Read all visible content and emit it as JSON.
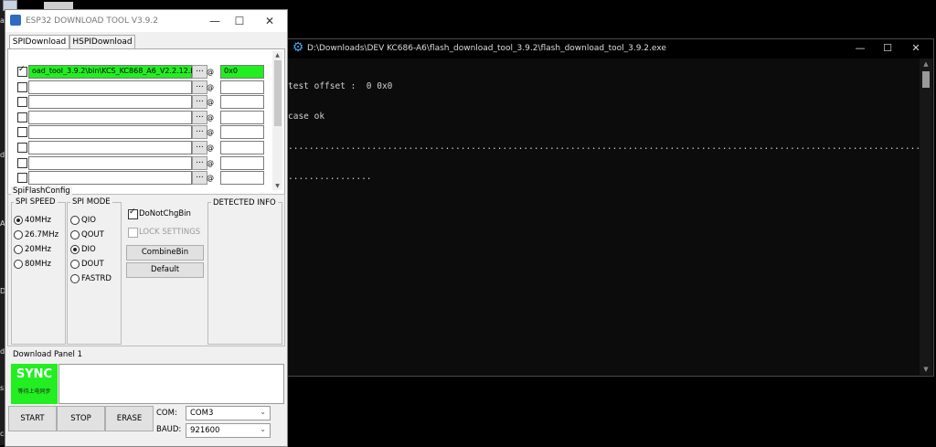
{
  "desktop": {
    "fragments": [
      "ac",
      "de",
      "AD",
      "D",
      "di",
      "s",
      "ca"
    ]
  },
  "console": {
    "title": "D:\\Downloads\\DEV KC686-A6\\flash_download_tool_3.9.2\\flash_download_tool_3.9.2.exe",
    "lines": [
      "test offset :  0 0x0",
      "case ok",
      "......................................................................................................................................",
      "................"
    ],
    "icons": {
      "app": "gear-icon",
      "minimize": "minimize-icon",
      "maximize": "maximize-icon",
      "close": "close-icon"
    }
  },
  "tool": {
    "title": "ESP32 DOWNLOAD TOOL V3.9.2",
    "tabs": [
      {
        "label": "SPIDownload"
      },
      {
        "label": "HSPIDownload"
      }
    ],
    "rows": [
      {
        "checked": true,
        "path": "oad_tool_3.9.2\\bin\\KCS_KC868_A6_V2.2.12.bin",
        "browse": "...",
        "at": "@",
        "addr": "0x0"
      },
      {
        "checked": false,
        "path": "",
        "browse": "...",
        "at": "@",
        "addr": ""
      },
      {
        "checked": false,
        "path": "",
        "browse": "...",
        "at": "@",
        "addr": ""
      },
      {
        "checked": false,
        "path": "",
        "browse": "...",
        "at": "@",
        "addr": ""
      },
      {
        "checked": false,
        "path": "",
        "browse": "...",
        "at": "@",
        "addr": ""
      },
      {
        "checked": false,
        "path": "",
        "browse": "...",
        "at": "@",
        "addr": ""
      },
      {
        "checked": false,
        "path": "",
        "browse": "...",
        "at": "@",
        "addr": ""
      },
      {
        "checked": false,
        "path": "",
        "browse": "...",
        "at": "@",
        "addr": ""
      }
    ],
    "spi_flash_config": {
      "title": "SpiFlashConfig",
      "spi_speed": {
        "title": "SPI SPEED",
        "options": [
          "40MHz",
          "26.7MHz",
          "20MHz",
          "80MHz"
        ],
        "selected": "40MHz"
      },
      "spi_mode": {
        "title": "SPI MODE",
        "options": [
          "QIO",
          "QOUT",
          "DIO",
          "DOUT",
          "FASTRD"
        ],
        "selected": "DIO"
      },
      "do_not_chg_bin": {
        "label": "DoNotChgBin",
        "checked": true
      },
      "lock_settings": {
        "label": "LOCK SETTINGS",
        "checked": false
      },
      "combine_bin_label": "CombineBin",
      "default_label": "Default",
      "detected_info_title": "DETECTED INFO"
    },
    "download_panel": {
      "title": "Download Panel 1",
      "sync_label": "SYNC",
      "sync_sub": "等待上电同步",
      "start_label": "START",
      "stop_label": "STOP",
      "erase_label": "ERASE",
      "com_label": "COM:",
      "com_value": "COM3",
      "baud_label": "BAUD:",
      "baud_value": "921600"
    }
  },
  "colors": {
    "green": "#22ee22",
    "console_bg": "#0c0c0c",
    "window_bg": "#f0f0f0"
  }
}
